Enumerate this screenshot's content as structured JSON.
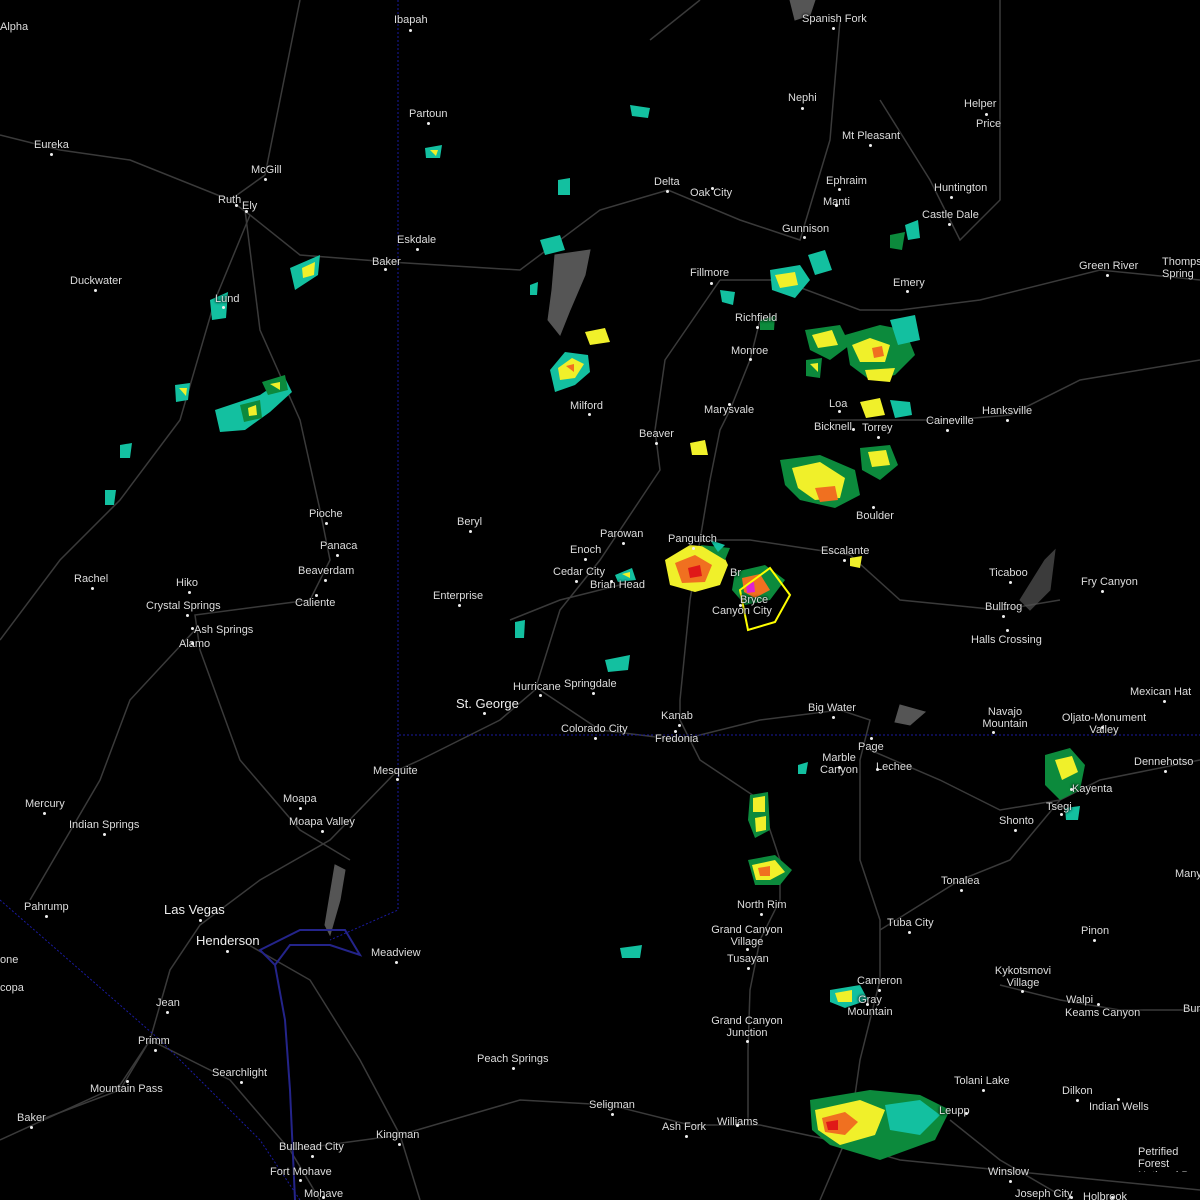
{
  "map": {
    "type": "radar",
    "colors": {
      "background": "#000000",
      "roads": "#3a3a3a",
      "state_border": "#1a1aa0",
      "lake": "#555555",
      "warning_polygon": "#ffff00",
      "radar_green": "#0c8a3c",
      "radar_teal": "#13c0a0",
      "radar_yellow": "#f0f02a",
      "radar_orange": "#f07020",
      "radar_red": "#e01818",
      "radar_magenta": "#e020d0"
    },
    "places": [
      {
        "id": "alpha",
        "name": "Alpha"
      },
      {
        "id": "ibapah",
        "name": "Ibapah"
      },
      {
        "id": "spanish-fork",
        "name": "Spanish Fork"
      },
      {
        "id": "nephi",
        "name": "Nephi"
      },
      {
        "id": "helper",
        "name": "Helper"
      },
      {
        "id": "price",
        "name": "Price"
      },
      {
        "id": "partoun",
        "name": "Partoun"
      },
      {
        "id": "eureka",
        "name": "Eureka"
      },
      {
        "id": "mcgill",
        "name": "McGill"
      },
      {
        "id": "mt-pleasant",
        "name": "Mt Pleasant"
      },
      {
        "id": "ruth",
        "name": "Ruth"
      },
      {
        "id": "ely",
        "name": "Ely"
      },
      {
        "id": "delta",
        "name": "Delta"
      },
      {
        "id": "oak-city",
        "name": "Oak City"
      },
      {
        "id": "ephraim",
        "name": "Ephraim"
      },
      {
        "id": "huntington",
        "name": "Huntington"
      },
      {
        "id": "manti",
        "name": "Manti"
      },
      {
        "id": "castle-dale",
        "name": "Castle Dale"
      },
      {
        "id": "eskdale",
        "name": "Eskdale"
      },
      {
        "id": "gunnison",
        "name": "Gunnison"
      },
      {
        "id": "baker",
        "name": "Baker"
      },
      {
        "id": "green-river",
        "name": "Green River"
      },
      {
        "id": "thompson-springs",
        "name": "Thomps Spring"
      },
      {
        "id": "duckwater",
        "name": "Duckwater"
      },
      {
        "id": "fillmore",
        "name": "Fillmore"
      },
      {
        "id": "emery",
        "name": "Emery"
      },
      {
        "id": "lund",
        "name": "Lund"
      },
      {
        "id": "richfield",
        "name": "Richfield"
      },
      {
        "id": "monroe",
        "name": "Monroe"
      },
      {
        "id": "milford",
        "name": "Milford"
      },
      {
        "id": "marysvale",
        "name": "Marysvale"
      },
      {
        "id": "loa",
        "name": "Loa"
      },
      {
        "id": "hanksville",
        "name": "Hanksville"
      },
      {
        "id": "caineville",
        "name": "Caineville"
      },
      {
        "id": "beaver",
        "name": "Beaver"
      },
      {
        "id": "bicknell",
        "name": "Bicknell"
      },
      {
        "id": "torrey",
        "name": "Torrey"
      },
      {
        "id": "pioche",
        "name": "Pioche"
      },
      {
        "id": "beryl",
        "name": "Beryl"
      },
      {
        "id": "boulder",
        "name": "Boulder"
      },
      {
        "id": "panaca",
        "name": "Panaca"
      },
      {
        "id": "parowan",
        "name": "Parowan"
      },
      {
        "id": "panguitch",
        "name": "Panguitch"
      },
      {
        "id": "escalante",
        "name": "Escalante"
      },
      {
        "id": "enoch",
        "name": "Enoch"
      },
      {
        "id": "beaverdam",
        "name": "Beaverdam"
      },
      {
        "id": "rachel",
        "name": "Rachel"
      },
      {
        "id": "cedar-city",
        "name": "Cedar City"
      },
      {
        "id": "ticaboo",
        "name": "Ticaboo"
      },
      {
        "id": "hiko",
        "name": "Hiko"
      },
      {
        "id": "brian-head",
        "name": "Brian Head"
      },
      {
        "id": "fry-canyon",
        "name": "Fry Canyon"
      },
      {
        "id": "crystal-springs",
        "name": "Crystal Springs"
      },
      {
        "id": "enterprise",
        "name": "Enterprise"
      },
      {
        "id": "caliente",
        "name": "Caliente"
      },
      {
        "id": "bryce",
        "name": "Bryce"
      },
      {
        "id": "bryce-partial",
        "name": "Br"
      },
      {
        "id": "canyon-city",
        "name": "Canyon City"
      },
      {
        "id": "bullfrog",
        "name": "Bullfrog"
      },
      {
        "id": "ash-springs",
        "name": "Ash Springs"
      },
      {
        "id": "alamo",
        "name": "Alamo"
      },
      {
        "id": "halls-crossing",
        "name": "Halls Crossing"
      },
      {
        "id": "hurricane",
        "name": "Hurricane"
      },
      {
        "id": "springdale",
        "name": "Springdale"
      },
      {
        "id": "mexican-hat",
        "name": "Mexican Hat"
      },
      {
        "id": "st-george",
        "name": "St. George"
      },
      {
        "id": "big-water",
        "name": "Big Water"
      },
      {
        "id": "kanab",
        "name": "Kanab"
      },
      {
        "id": "navajo-mountain",
        "name": "Navajo Mountain"
      },
      {
        "id": "oljato",
        "name": "Oljato-Monument Valley"
      },
      {
        "id": "colorado-city",
        "name": "Colorado City"
      },
      {
        "id": "fredonia",
        "name": "Fredonia"
      },
      {
        "id": "page",
        "name": "Page"
      },
      {
        "id": "marble-canyon",
        "name": "Marble Canyon"
      },
      {
        "id": "lechee",
        "name": "Lechee"
      },
      {
        "id": "dennehotso",
        "name": "Dennehotso"
      },
      {
        "id": "mesquite",
        "name": "Mesquite"
      },
      {
        "id": "kayenta",
        "name": "Kayenta"
      },
      {
        "id": "mercury",
        "name": "Mercury"
      },
      {
        "id": "moapa",
        "name": "Moapa"
      },
      {
        "id": "tsegi",
        "name": "Tsegi"
      },
      {
        "id": "shonto",
        "name": "Shonto"
      },
      {
        "id": "indian-springs",
        "name": "Indian Springs"
      },
      {
        "id": "moapa-valley",
        "name": "Moapa Valley"
      },
      {
        "id": "many",
        "name": "Many"
      },
      {
        "id": "tonalea",
        "name": "Tonalea"
      },
      {
        "id": "pahrump",
        "name": "Pahrump"
      },
      {
        "id": "north-rim",
        "name": "North Rim"
      },
      {
        "id": "las-vegas",
        "name": "Las Vegas"
      },
      {
        "id": "tuba-city",
        "name": "Tuba City"
      },
      {
        "id": "grand-canyon-village",
        "name": "Grand Canyon Village"
      },
      {
        "id": "pinon",
        "name": "Pinon"
      },
      {
        "id": "henderson",
        "name": "Henderson"
      },
      {
        "id": "meadview",
        "name": "Meadview"
      },
      {
        "id": "tusayan",
        "name": "Tusayan"
      },
      {
        "id": "one",
        "name": "one"
      },
      {
        "id": "cameron",
        "name": "Cameron"
      },
      {
        "id": "kykotsmovi",
        "name": "Kykotsmovi Village"
      },
      {
        "id": "copa",
        "name": "copa"
      },
      {
        "id": "gray-mountain",
        "name": "Gray Mountain"
      },
      {
        "id": "jean",
        "name": "Jean"
      },
      {
        "id": "walpi",
        "name": "Walpi"
      },
      {
        "id": "keams-canyon",
        "name": "Keams Canyon"
      },
      {
        "id": "bur",
        "name": "Bur"
      },
      {
        "id": "grand-canyon-junction",
        "name": "Grand Canyon Junction"
      },
      {
        "id": "primm",
        "name": "Primm"
      },
      {
        "id": "peach-springs",
        "name": "Peach Springs"
      },
      {
        "id": "searchlight",
        "name": "Searchlight"
      },
      {
        "id": "tolani-lake",
        "name": "Tolani Lake"
      },
      {
        "id": "mountain-pass",
        "name": "Mountain Pass"
      },
      {
        "id": "dilkon",
        "name": "Dilkon"
      },
      {
        "id": "seligman",
        "name": "Seligman"
      },
      {
        "id": "leupp",
        "name": "Leupp"
      },
      {
        "id": "indian-wells",
        "name": "Indian Wells"
      },
      {
        "id": "baker-ca",
        "name": "Baker"
      },
      {
        "id": "ash-fork",
        "name": "Ash Fork"
      },
      {
        "id": "williams",
        "name": "Williams"
      },
      {
        "id": "kingman",
        "name": "Kingman"
      },
      {
        "id": "petrified-forest",
        "name": "Petrified Forest National Pa"
      },
      {
        "id": "bullhead-city",
        "name": "Bullhead City"
      },
      {
        "id": "winslow",
        "name": "Winslow"
      },
      {
        "id": "fort-mohave",
        "name": "Fort Mohave"
      },
      {
        "id": "joseph-city",
        "name": "Joseph City"
      },
      {
        "id": "holbrook",
        "name": "Holbrook"
      },
      {
        "id": "mohave",
        "name": "Mohave"
      }
    ]
  }
}
